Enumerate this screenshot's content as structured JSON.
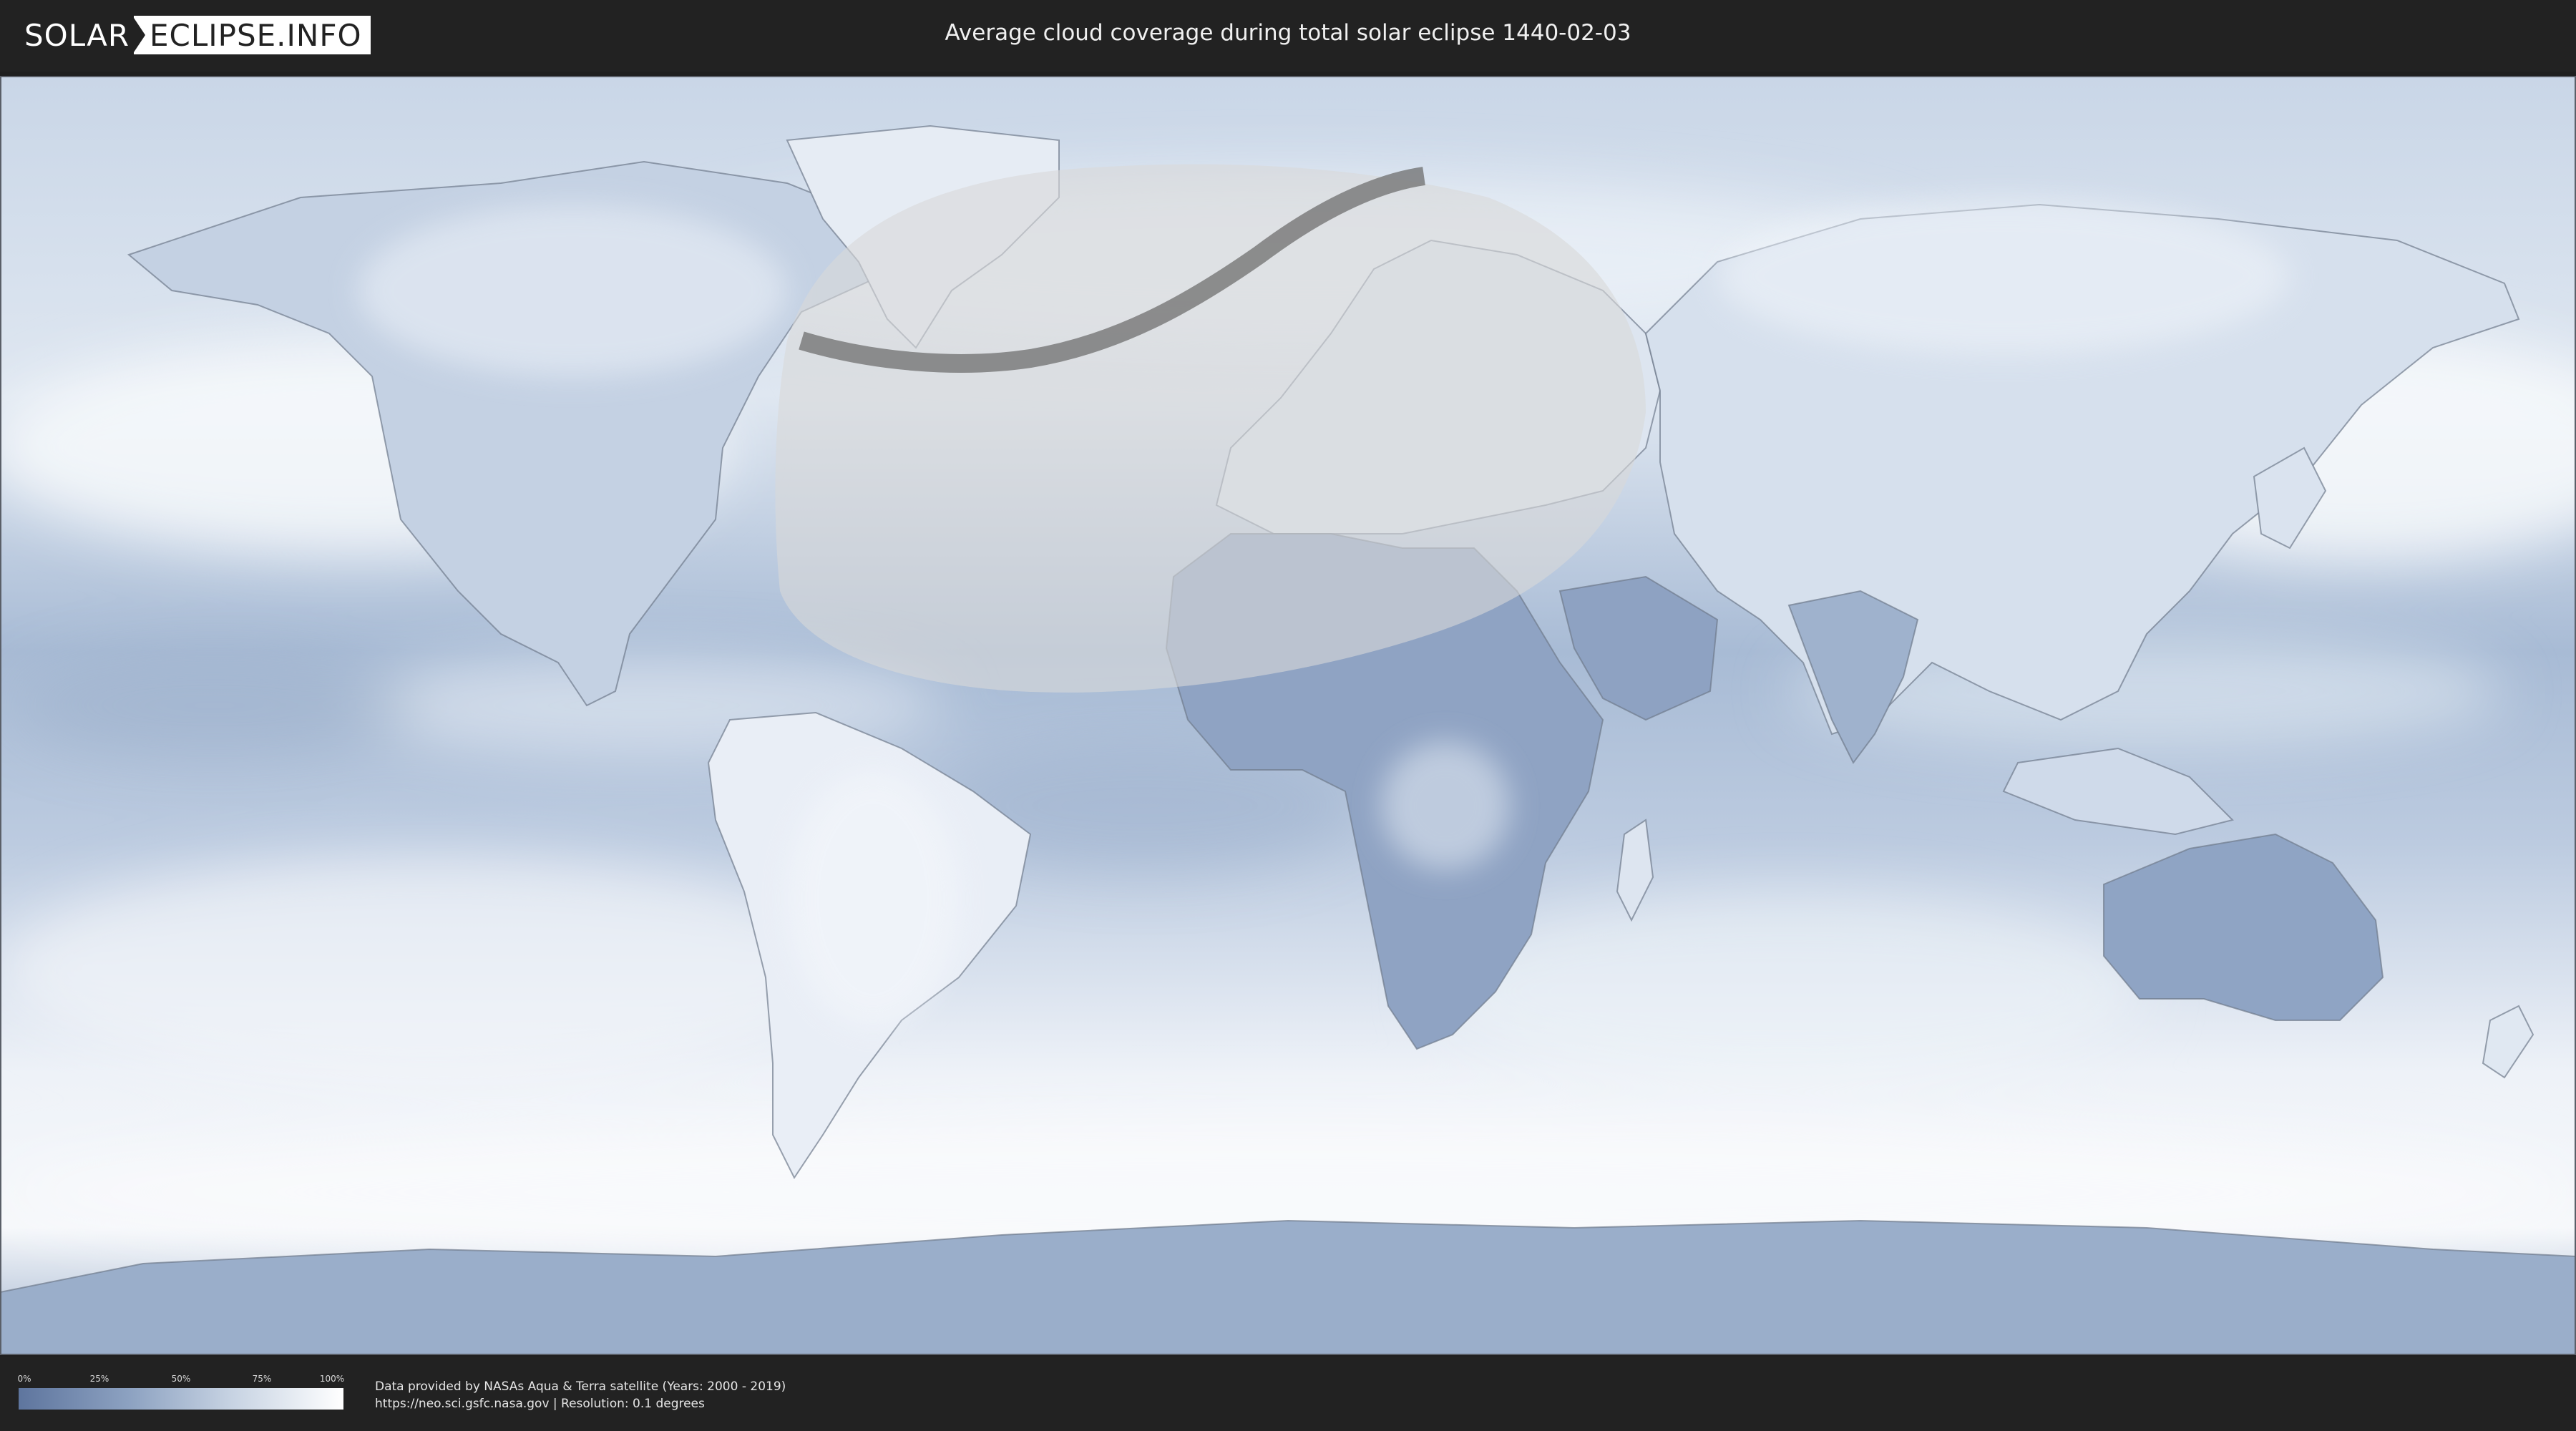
{
  "header": {
    "logo_part1": "SOLAR",
    "logo_part2": "ECLIPSE.INFO",
    "title": "Average cloud coverage during total solar eclipse 1440-02-03"
  },
  "map": {
    "colors": {
      "ocean_clear": "#8fa6c6",
      "cloud_white": "#f4f7fb",
      "land_border": "#7b8596",
      "eclipse_visibility_zone": "#d8d8d8",
      "totality_path": "#6e6e6e"
    }
  },
  "legend": {
    "ticks": [
      "0%",
      "25%",
      "50%",
      "75%",
      "100%"
    ],
    "gradient_start": "#5e759e",
    "gradient_end": "#ffffff"
  },
  "footer": {
    "credit_line1": "Data provided by NASAs Aqua & Terra satellite (Years: 2000 - 2019)",
    "credit_line2": "https://neo.sci.gsfc.nasa.gov | Resolution: 0.1 degrees"
  }
}
